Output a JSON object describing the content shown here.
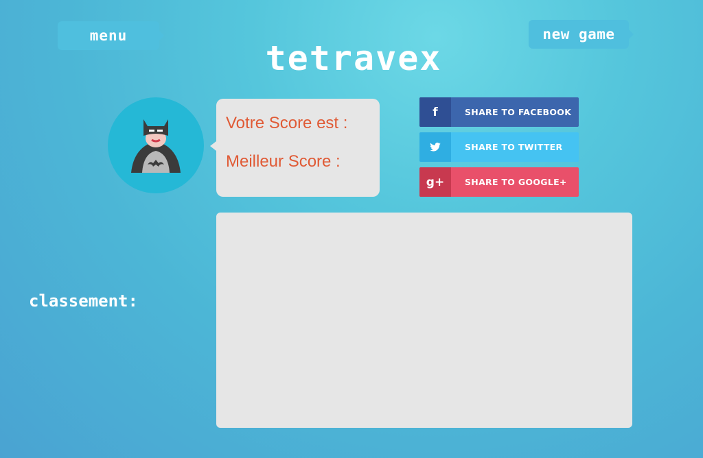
{
  "header": {
    "menu_label": "menu",
    "new_game_label": "new game",
    "logo_text": "tetravex"
  },
  "score_card": {
    "score_label": "Votre Score est :",
    "best_label": "Meilleur Score :"
  },
  "share": {
    "facebook": {
      "icon": "f",
      "label": "SHARE TO FACEBOOK",
      "color": "#3c66ad"
    },
    "twitter": {
      "icon": "twitter-bird",
      "label": "SHARE TO TWITTER",
      "color": "#45c3f2"
    },
    "google": {
      "icon": "g+",
      "label": "SHARE TO GOOGLE+",
      "color": "#e9506a"
    }
  },
  "ranking": {
    "label": "classement:"
  },
  "colors": {
    "accent": "#4fbfde",
    "score_text": "#e05a35",
    "panel": "#e6e6e6",
    "avatar_bg": "#25b8d6"
  }
}
